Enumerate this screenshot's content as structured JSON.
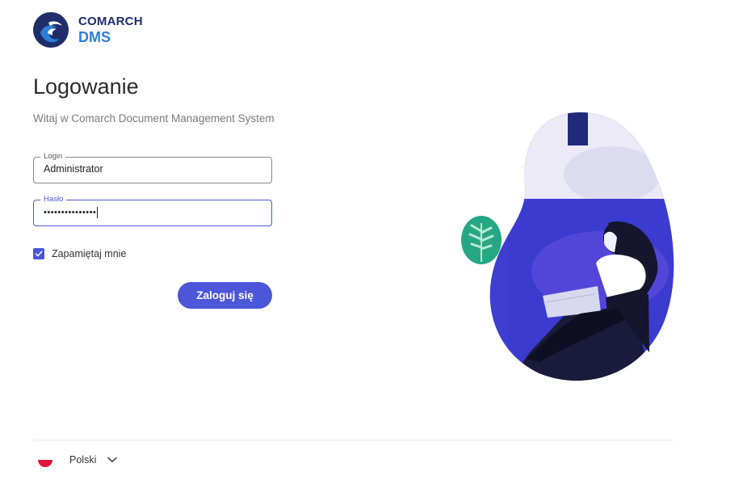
{
  "brand": {
    "name": "COMARCH",
    "product": "DMS",
    "logo_icon": "comarch-logo-icon",
    "primary_color": "#1f2d6b",
    "secondary_color": "#2e7fd6"
  },
  "page": {
    "title": "Logowanie",
    "subtitle": "Witaj w Comarch Document Management System"
  },
  "form": {
    "login": {
      "label": "Login",
      "value": "Administrator"
    },
    "password": {
      "label": "Hasło",
      "masked_value": "•••••••••••••••"
    },
    "remember": {
      "label": "Zapamiętaj mnie",
      "checked": true
    },
    "submit_label": "Zaloguj się",
    "accent_color": "#4b56d8"
  },
  "footer": {
    "language": {
      "label": "Polski",
      "flag_icon": "poland-flag-icon",
      "dropdown_icon": "chevron-down-icon"
    }
  }
}
